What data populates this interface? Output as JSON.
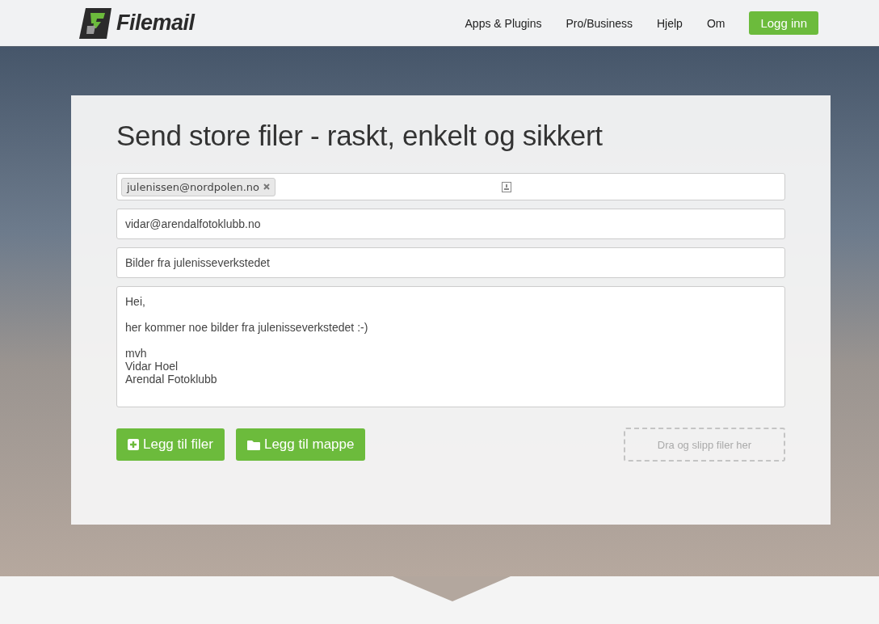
{
  "header": {
    "logo": "Filemail",
    "nav": [
      "Apps & Plugins",
      "Pro/Business",
      "Hjelp",
      "Om"
    ],
    "login_button": "Logg inn"
  },
  "form": {
    "title": "Send store filer - raskt, enkelt og sikkert",
    "recipients": [
      "julenissen@nordpolen.no"
    ],
    "sender": "vidar@arendalfotoklubb.no",
    "subject": "Bilder fra julenisseverkstedet",
    "message": "Hei,\n\nher kommer noe bilder fra julenisseverkstedet :-)\n\nmvh\nVidar Hoel\nArendal Fotoklubb",
    "buttons": [
      {
        "label": "Legg til filer",
        "kind": "files"
      },
      {
        "label": "Legg til mappe",
        "kind": "folder"
      }
    ],
    "drop_zone": "Dra og slipp filer her"
  }
}
